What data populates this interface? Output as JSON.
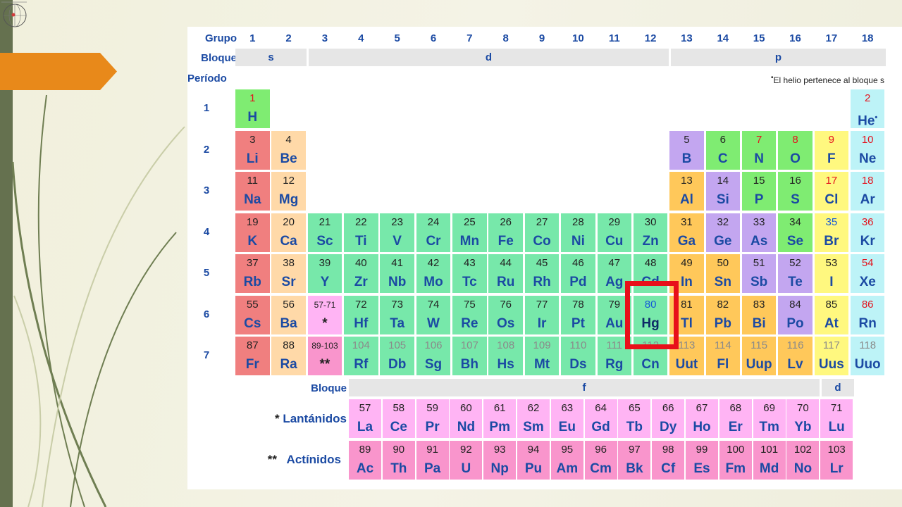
{
  "labels": {
    "grupo": "Grupo",
    "bloque": "Bloque",
    "periodo": "Período",
    "helium_note": "El helio pertenece al bloque s",
    "bloque_f_rows": "Bloque",
    "lantanidos": "Lantánidos",
    "actinidos": "Actínidos",
    "lantanidos_mark": "*",
    "actinidos_mark": "**"
  },
  "groups": [
    "1",
    "2",
    "3",
    "4",
    "5",
    "6",
    "7",
    "8",
    "9",
    "10",
    "11",
    "12",
    "13",
    "14",
    "15",
    "16",
    "17",
    "18"
  ],
  "periods": [
    "1",
    "2",
    "3",
    "4",
    "5",
    "6",
    "7"
  ],
  "blocks": {
    "s": "s",
    "d": "d",
    "p": "p",
    "f": "f",
    "d2": "d"
  },
  "colors": {
    "alkali": "#f07f7f",
    "alkaline": "#ffd9a8",
    "transition": "#77e8aa",
    "post_transition": "#ffc85a",
    "metalloid": "#c3a6f0",
    "nonmetal": "#7fec72",
    "halogen": "#fff87f",
    "noble": "#bdf3f7",
    "lanthanide": "#ffb4f4",
    "actinide": "#f995cc",
    "num_default": "#222222",
    "num_gas": "#e3141e",
    "num_liquid": "#1358d8",
    "num_unknown": "#8a8a8a",
    "symbol": "#1b4aa3",
    "highlight": "#e8101a",
    "accent_tab": "#e8891a",
    "side_bar": "#65714f"
  },
  "elements": [
    {
      "n": "1",
      "s": "H",
      "g": 1,
      "p": 1,
      "c": "nonmetal",
      "nc": "num_gas"
    },
    {
      "n": "2",
      "s": "He",
      "g": 18,
      "p": 1,
      "c": "noble",
      "nc": "num_gas",
      "mark": "•"
    },
    {
      "n": "3",
      "s": "Li",
      "g": 1,
      "p": 2,
      "c": "alkali"
    },
    {
      "n": "4",
      "s": "Be",
      "g": 2,
      "p": 2,
      "c": "alkaline"
    },
    {
      "n": "5",
      "s": "B",
      "g": 13,
      "p": 2,
      "c": "metalloid"
    },
    {
      "n": "6",
      "s": "C",
      "g": 14,
      "p": 2,
      "c": "nonmetal"
    },
    {
      "n": "7",
      "s": "N",
      "g": 15,
      "p": 2,
      "c": "nonmetal",
      "nc": "num_gas"
    },
    {
      "n": "8",
      "s": "O",
      "g": 16,
      "p": 2,
      "c": "nonmetal",
      "nc": "num_gas"
    },
    {
      "n": "9",
      "s": "F",
      "g": 17,
      "p": 2,
      "c": "halogen",
      "nc": "num_gas"
    },
    {
      "n": "10",
      "s": "Ne",
      "g": 18,
      "p": 2,
      "c": "noble",
      "nc": "num_gas"
    },
    {
      "n": "11",
      "s": "Na",
      "g": 1,
      "p": 3,
      "c": "alkali"
    },
    {
      "n": "12",
      "s": "Mg",
      "g": 2,
      "p": 3,
      "c": "alkaline"
    },
    {
      "n": "13",
      "s": "Al",
      "g": 13,
      "p": 3,
      "c": "post_transition"
    },
    {
      "n": "14",
      "s": "Si",
      "g": 14,
      "p": 3,
      "c": "metalloid"
    },
    {
      "n": "15",
      "s": "P",
      "g": 15,
      "p": 3,
      "c": "nonmetal"
    },
    {
      "n": "16",
      "s": "S",
      "g": 16,
      "p": 3,
      "c": "nonmetal"
    },
    {
      "n": "17",
      "s": "Cl",
      "g": 17,
      "p": 3,
      "c": "halogen",
      "nc": "num_gas"
    },
    {
      "n": "18",
      "s": "Ar",
      "g": 18,
      "p": 3,
      "c": "noble",
      "nc": "num_gas"
    },
    {
      "n": "19",
      "s": "K",
      "g": 1,
      "p": 4,
      "c": "alkali"
    },
    {
      "n": "20",
      "s": "Ca",
      "g": 2,
      "p": 4,
      "c": "alkaline"
    },
    {
      "n": "21",
      "s": "Sc",
      "g": 3,
      "p": 4,
      "c": "transition"
    },
    {
      "n": "22",
      "s": "Ti",
      "g": 4,
      "p": 4,
      "c": "transition"
    },
    {
      "n": "23",
      "s": "V",
      "g": 5,
      "p": 4,
      "c": "transition"
    },
    {
      "n": "24",
      "s": "Cr",
      "g": 6,
      "p": 4,
      "c": "transition"
    },
    {
      "n": "25",
      "s": "Mn",
      "g": 7,
      "p": 4,
      "c": "transition"
    },
    {
      "n": "26",
      "s": "Fe",
      "g": 8,
      "p": 4,
      "c": "transition"
    },
    {
      "n": "27",
      "s": "Co",
      "g": 9,
      "p": 4,
      "c": "transition"
    },
    {
      "n": "28",
      "s": "Ni",
      "g": 10,
      "p": 4,
      "c": "transition"
    },
    {
      "n": "29",
      "s": "Cu",
      "g": 11,
      "p": 4,
      "c": "transition"
    },
    {
      "n": "30",
      "s": "Zn",
      "g": 12,
      "p": 4,
      "c": "transition"
    },
    {
      "n": "31",
      "s": "Ga",
      "g": 13,
      "p": 4,
      "c": "post_transition"
    },
    {
      "n": "32",
      "s": "Ge",
      "g": 14,
      "p": 4,
      "c": "metalloid"
    },
    {
      "n": "33",
      "s": "As",
      "g": 15,
      "p": 4,
      "c": "metalloid"
    },
    {
      "n": "34",
      "s": "Se",
      "g": 16,
      "p": 4,
      "c": "nonmetal"
    },
    {
      "n": "35",
      "s": "Br",
      "g": 17,
      "p": 4,
      "c": "halogen",
      "nc": "num_liquid"
    },
    {
      "n": "36",
      "s": "Kr",
      "g": 18,
      "p": 4,
      "c": "noble",
      "nc": "num_gas"
    },
    {
      "n": "37",
      "s": "Rb",
      "g": 1,
      "p": 5,
      "c": "alkali"
    },
    {
      "n": "38",
      "s": "Sr",
      "g": 2,
      "p": 5,
      "c": "alkaline"
    },
    {
      "n": "39",
      "s": "Y",
      "g": 3,
      "p": 5,
      "c": "transition"
    },
    {
      "n": "40",
      "s": "Zr",
      "g": 4,
      "p": 5,
      "c": "transition"
    },
    {
      "n": "41",
      "s": "Nb",
      "g": 5,
      "p": 5,
      "c": "transition"
    },
    {
      "n": "42",
      "s": "Mo",
      "g": 6,
      "p": 5,
      "c": "transition"
    },
    {
      "n": "43",
      "s": "Tc",
      "g": 7,
      "p": 5,
      "c": "transition"
    },
    {
      "n": "44",
      "s": "Ru",
      "g": 8,
      "p": 5,
      "c": "transition"
    },
    {
      "n": "45",
      "s": "Rh",
      "g": 9,
      "p": 5,
      "c": "transition"
    },
    {
      "n": "46",
      "s": "Pd",
      "g": 10,
      "p": 5,
      "c": "transition"
    },
    {
      "n": "47",
      "s": "Ag",
      "g": 11,
      "p": 5,
      "c": "transition"
    },
    {
      "n": "48",
      "s": "Cd",
      "g": 12,
      "p": 5,
      "c": "transition"
    },
    {
      "n": "49",
      "s": "In",
      "g": 13,
      "p": 5,
      "c": "post_transition"
    },
    {
      "n": "50",
      "s": "Sn",
      "g": 14,
      "p": 5,
      "c": "post_transition"
    },
    {
      "n": "51",
      "s": "Sb",
      "g": 15,
      "p": 5,
      "c": "metalloid"
    },
    {
      "n": "52",
      "s": "Te",
      "g": 16,
      "p": 5,
      "c": "metalloid"
    },
    {
      "n": "53",
      "s": "I",
      "g": 17,
      "p": 5,
      "c": "halogen"
    },
    {
      "n": "54",
      "s": "Xe",
      "g": 18,
      "p": 5,
      "c": "noble",
      "nc": "num_gas"
    },
    {
      "n": "55",
      "s": "Cs",
      "g": 1,
      "p": 6,
      "c": "alkali"
    },
    {
      "n": "56",
      "s": "Ba",
      "g": 2,
      "p": 6,
      "c": "alkaline"
    },
    {
      "n": "57-71",
      "s": "*",
      "g": 3,
      "p": 6,
      "c": "lanthanide",
      "small": true
    },
    {
      "n": "72",
      "s": "Hf",
      "g": 4,
      "p": 6,
      "c": "transition"
    },
    {
      "n": "73",
      "s": "Ta",
      "g": 5,
      "p": 6,
      "c": "transition"
    },
    {
      "n": "74",
      "s": "W",
      "g": 6,
      "p": 6,
      "c": "transition"
    },
    {
      "n": "75",
      "s": "Re",
      "g": 7,
      "p": 6,
      "c": "transition"
    },
    {
      "n": "76",
      "s": "Os",
      "g": 8,
      "p": 6,
      "c": "transition"
    },
    {
      "n": "77",
      "s": "Ir",
      "g": 9,
      "p": 6,
      "c": "transition"
    },
    {
      "n": "78",
      "s": "Pt",
      "g": 10,
      "p": 6,
      "c": "transition"
    },
    {
      "n": "79",
      "s": "Au",
      "g": 11,
      "p": 6,
      "c": "transition"
    },
    {
      "n": "80",
      "s": "Hg",
      "g": 12,
      "p": 6,
      "c": "transition",
      "nc": "num_liquid",
      "selected": true
    },
    {
      "n": "81",
      "s": "Tl",
      "g": 13,
      "p": 6,
      "c": "post_transition"
    },
    {
      "n": "82",
      "s": "Pb",
      "g": 14,
      "p": 6,
      "c": "post_transition"
    },
    {
      "n": "83",
      "s": "Bi",
      "g": 15,
      "p": 6,
      "c": "post_transition"
    },
    {
      "n": "84",
      "s": "Po",
      "g": 16,
      "p": 6,
      "c": "metalloid"
    },
    {
      "n": "85",
      "s": "At",
      "g": 17,
      "p": 6,
      "c": "halogen"
    },
    {
      "n": "86",
      "s": "Rn",
      "g": 18,
      "p": 6,
      "c": "noble",
      "nc": "num_gas"
    },
    {
      "n": "87",
      "s": "Fr",
      "g": 1,
      "p": 7,
      "c": "alkali"
    },
    {
      "n": "88",
      "s": "Ra",
      "g": 2,
      "p": 7,
      "c": "alkaline"
    },
    {
      "n": "89-103",
      "s": "**",
      "g": 3,
      "p": 7,
      "c": "actinide",
      "small": true
    },
    {
      "n": "104",
      "s": "Rf",
      "g": 4,
      "p": 7,
      "c": "transition",
      "nc": "num_unknown"
    },
    {
      "n": "105",
      "s": "Db",
      "g": 5,
      "p": 7,
      "c": "transition",
      "nc": "num_unknown"
    },
    {
      "n": "106",
      "s": "Sg",
      "g": 6,
      "p": 7,
      "c": "transition",
      "nc": "num_unknown"
    },
    {
      "n": "107",
      "s": "Bh",
      "g": 7,
      "p": 7,
      "c": "transition",
      "nc": "num_unknown"
    },
    {
      "n": "108",
      "s": "Hs",
      "g": 8,
      "p": 7,
      "c": "transition",
      "nc": "num_unknown"
    },
    {
      "n": "109",
      "s": "Mt",
      "g": 9,
      "p": 7,
      "c": "transition",
      "nc": "num_unknown"
    },
    {
      "n": "110",
      "s": "Ds",
      "g": 10,
      "p": 7,
      "c": "transition",
      "nc": "num_unknown"
    },
    {
      "n": "111",
      "s": "Rg",
      "g": 11,
      "p": 7,
      "c": "transition",
      "nc": "num_unknown"
    },
    {
      "n": "112",
      "s": "Cn",
      "g": 12,
      "p": 7,
      "c": "transition",
      "nc": "num_unknown"
    },
    {
      "n": "113",
      "s": "Uut",
      "g": 13,
      "p": 7,
      "c": "post_transition",
      "nc": "num_unknown"
    },
    {
      "n": "114",
      "s": "Fl",
      "g": 14,
      "p": 7,
      "c": "post_transition",
      "nc": "num_unknown"
    },
    {
      "n": "115",
      "s": "Uup",
      "g": 15,
      "p": 7,
      "c": "post_transition",
      "nc": "num_unknown"
    },
    {
      "n": "116",
      "s": "Lv",
      "g": 16,
      "p": 7,
      "c": "post_transition",
      "nc": "num_unknown"
    },
    {
      "n": "117",
      "s": "Uus",
      "g": 17,
      "p": 7,
      "c": "halogen",
      "nc": "num_unknown"
    },
    {
      "n": "118",
      "s": "Uuo",
      "g": 18,
      "p": 7,
      "c": "noble",
      "nc": "num_unknown"
    }
  ],
  "lanthanides": [
    {
      "n": "57",
      "s": "La"
    },
    {
      "n": "58",
      "s": "Ce"
    },
    {
      "n": "59",
      "s": "Pr"
    },
    {
      "n": "60",
      "s": "Nd"
    },
    {
      "n": "61",
      "s": "Pm"
    },
    {
      "n": "62",
      "s": "Sm"
    },
    {
      "n": "63",
      "s": "Eu"
    },
    {
      "n": "64",
      "s": "Gd"
    },
    {
      "n": "65",
      "s": "Tb"
    },
    {
      "n": "66",
      "s": "Dy"
    },
    {
      "n": "67",
      "s": "Ho"
    },
    {
      "n": "68",
      "s": "Er"
    },
    {
      "n": "69",
      "s": "Tm"
    },
    {
      "n": "70",
      "s": "Yb"
    },
    {
      "n": "71",
      "s": "Lu"
    }
  ],
  "actinides": [
    {
      "n": "89",
      "s": "Ac"
    },
    {
      "n": "90",
      "s": "Th"
    },
    {
      "n": "91",
      "s": "Pa"
    },
    {
      "n": "92",
      "s": "U"
    },
    {
      "n": "93",
      "s": "Np"
    },
    {
      "n": "94",
      "s": "Pu"
    },
    {
      "n": "95",
      "s": "Am"
    },
    {
      "n": "96",
      "s": "Cm"
    },
    {
      "n": "97",
      "s": "Bk"
    },
    {
      "n": "98",
      "s": "Cf"
    },
    {
      "n": "99",
      "s": "Es"
    },
    {
      "n": "100",
      "s": "Fm"
    },
    {
      "n": "101",
      "s": "Md"
    },
    {
      "n": "102",
      "s": "No"
    },
    {
      "n": "103",
      "s": "Lr"
    }
  ]
}
